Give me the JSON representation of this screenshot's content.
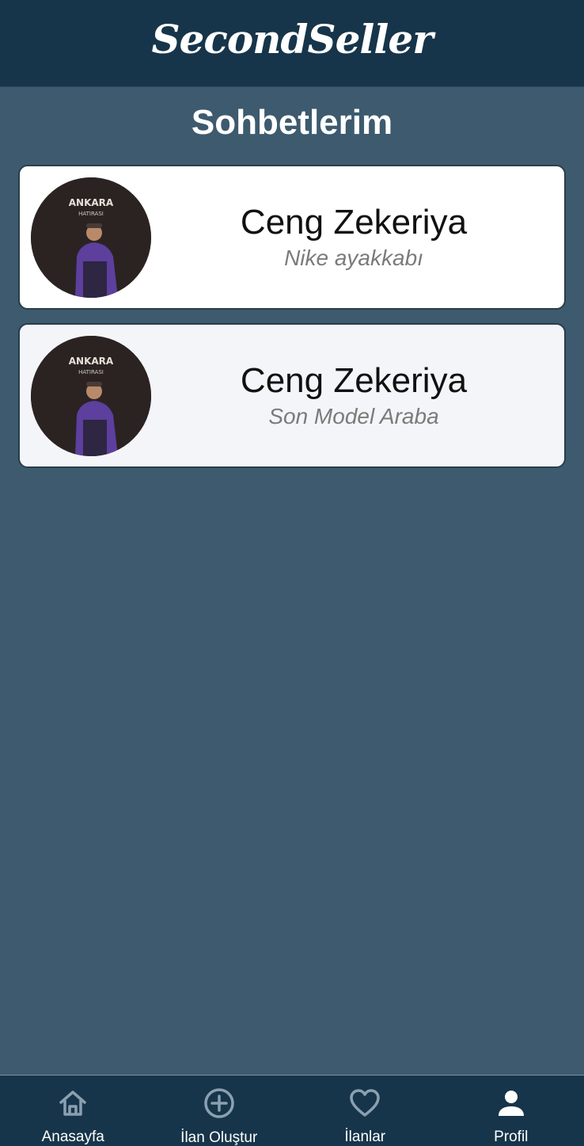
{
  "app": {
    "brand": "SecondSeller"
  },
  "page": {
    "title": "Sohbetlerim"
  },
  "chats": [
    {
      "name": "Ceng Zekeriya",
      "product": "Nike ayakkabı",
      "avatar_backdrop_text": "ANKARA",
      "avatar_backdrop_subtext": "HATIRASI"
    },
    {
      "name": "Ceng Zekeriya",
      "product": "Son Model Araba",
      "avatar_backdrop_text": "ANKARA",
      "avatar_backdrop_subtext": "HATIRASI"
    }
  ],
  "bottom_nav": {
    "items": [
      {
        "label": "Anasayfa",
        "icon": "home-icon"
      },
      {
        "label": "İlan Oluştur",
        "icon": "add-circle-icon"
      },
      {
        "label": "İlanlar",
        "icon": "heart-icon"
      },
      {
        "label": "Profil",
        "icon": "person-icon"
      }
    ]
  },
  "colors": {
    "header_bg": "#17354a",
    "page_bg": "#3d5a6e",
    "card_bg": "#ffffff",
    "text_secondary": "#7b7b7b",
    "nav_icon": "#8aa0b0"
  }
}
